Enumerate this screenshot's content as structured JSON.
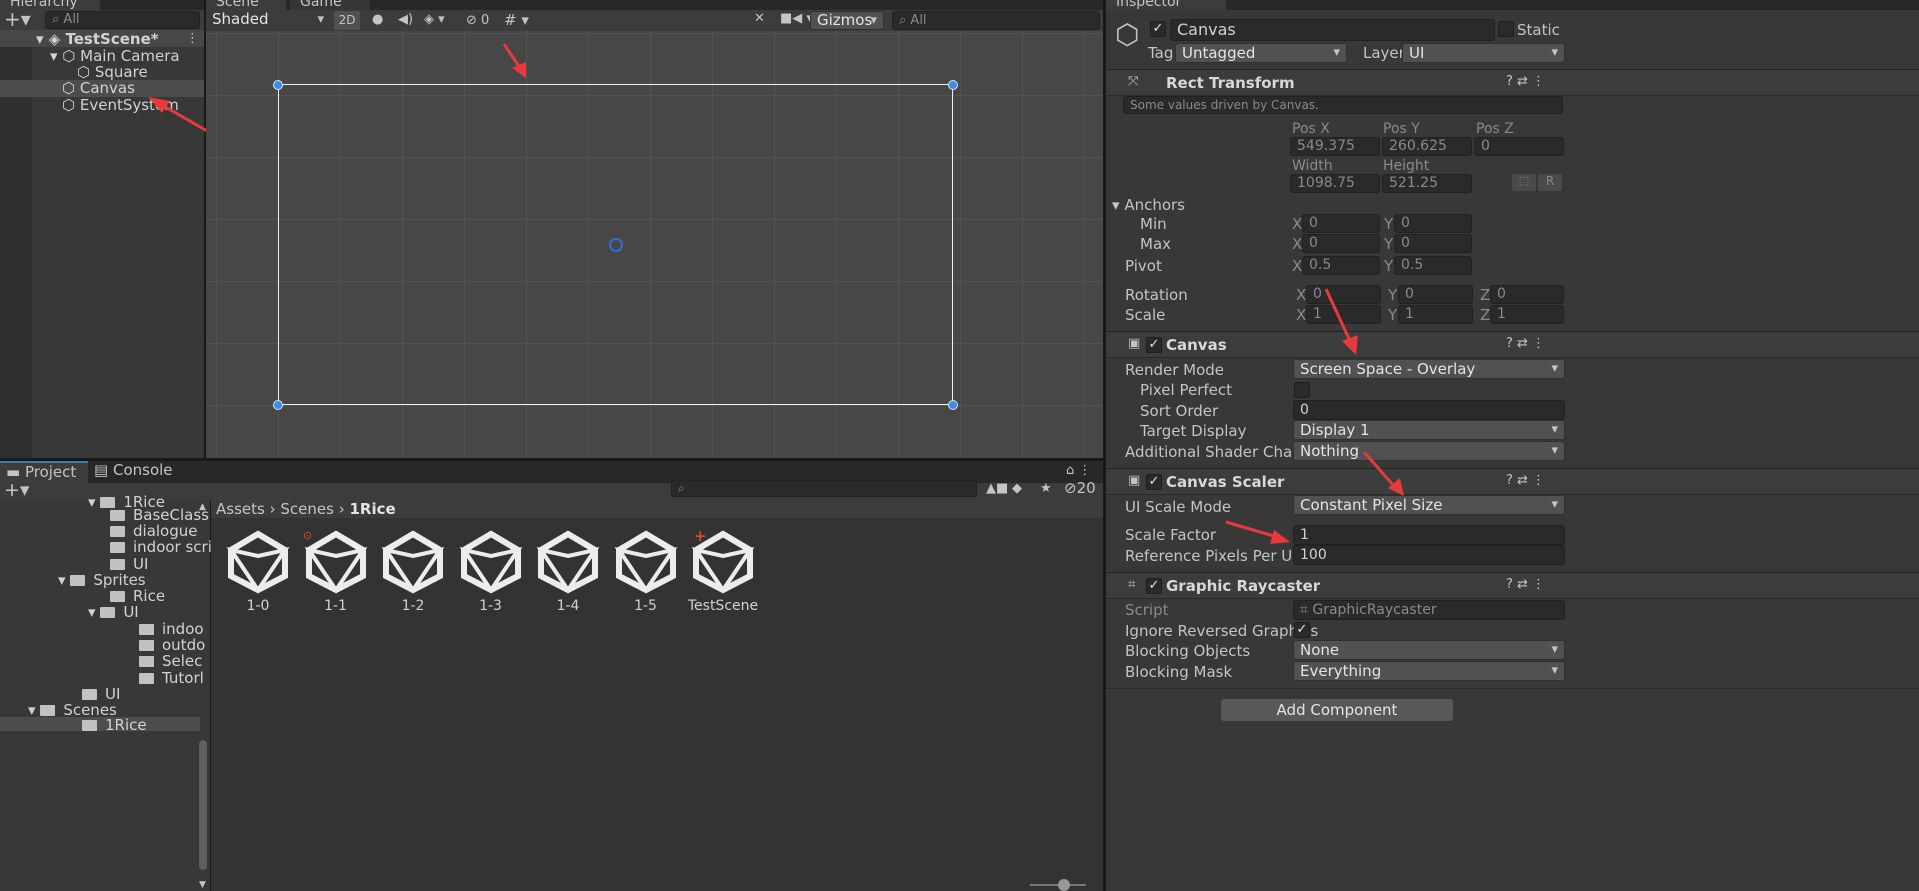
{
  "hierarchy": {
    "title": "Hierarchy",
    "search": "All",
    "scene": "TestScene*",
    "items": [
      "Main Camera",
      "Square",
      "Canvas",
      "EventSystem"
    ]
  },
  "scene": {
    "tabs": [
      "Scene",
      "Game"
    ],
    "shading": "Shaded",
    "mode2d": "2D",
    "hidden_count": "0",
    "gizmos": "Gizmos",
    "search": "All"
  },
  "inspector": {
    "title": "Inspector",
    "object_name": "Canvas",
    "static": "Static",
    "tag_label": "Tag",
    "tag": "Untagged",
    "layer_label": "Layer",
    "layer": "UI",
    "rect": {
      "title": "Rect Transform",
      "note": "Some values driven by Canvas.",
      "posx_l": "Pos X",
      "posy_l": "Pos Y",
      "posz_l": "Pos Z",
      "posx": "549.375",
      "posy": "260.625",
      "posz": "0",
      "width_l": "Width",
      "height_l": "Height",
      "width": "1098.75",
      "height": "521.25",
      "r": "R",
      "anchors": "Anchors",
      "min": "Min",
      "max": "Max",
      "x": "X",
      "y": "Y",
      "z": "Z",
      "zero": "0",
      "pivot": "Pivot",
      "half": "0.5",
      "rotation": "Rotation",
      "scale": "Scale",
      "one": "1"
    },
    "canvas": {
      "title": "Canvas",
      "render_mode_l": "Render Mode",
      "render_mode": "Screen Space - Overlay",
      "pixel_perfect": "Pixel Perfect",
      "sort_order_l": "Sort Order",
      "sort_order": "0",
      "target_display_l": "Target Display",
      "target_display": "Display 1",
      "shader_l": "Additional Shader Channels",
      "shader": "Nothing"
    },
    "scaler": {
      "title": "Canvas Scaler",
      "mode_l": "UI Scale Mode",
      "mode": "Constant Pixel Size",
      "factor_l": "Scale Factor",
      "factor": "1",
      "ref_l": "Reference Pixels Per Unit",
      "ref": "100"
    },
    "raycaster": {
      "title": "Graphic Raycaster",
      "script_l": "Script",
      "script": "GraphicRaycaster",
      "ignore_l": "Ignore Reversed Graphics",
      "blocking_l": "Blocking Objects",
      "blocking": "None",
      "mask_l": "Blocking Mask",
      "mask": "Everything"
    },
    "add_component": "Add Component"
  },
  "project": {
    "tabs": [
      "Project",
      "Console"
    ],
    "hidden_count": "20",
    "tree": [
      "1Rice",
      "BaseClass",
      "dialogue",
      "indoor scri",
      "UI",
      "Sprites",
      "Rice",
      "UI",
      "indoo",
      "outdo",
      "Selec",
      "Tutorl",
      "UI",
      "Scenes",
      "1Rice"
    ],
    "breadcrumb": [
      "Assets",
      "Scenes",
      "1Rice"
    ],
    "assets": [
      "1-0",
      "1-1",
      "1-2",
      "1-3",
      "1-4",
      "1-5",
      "TestScene"
    ]
  }
}
